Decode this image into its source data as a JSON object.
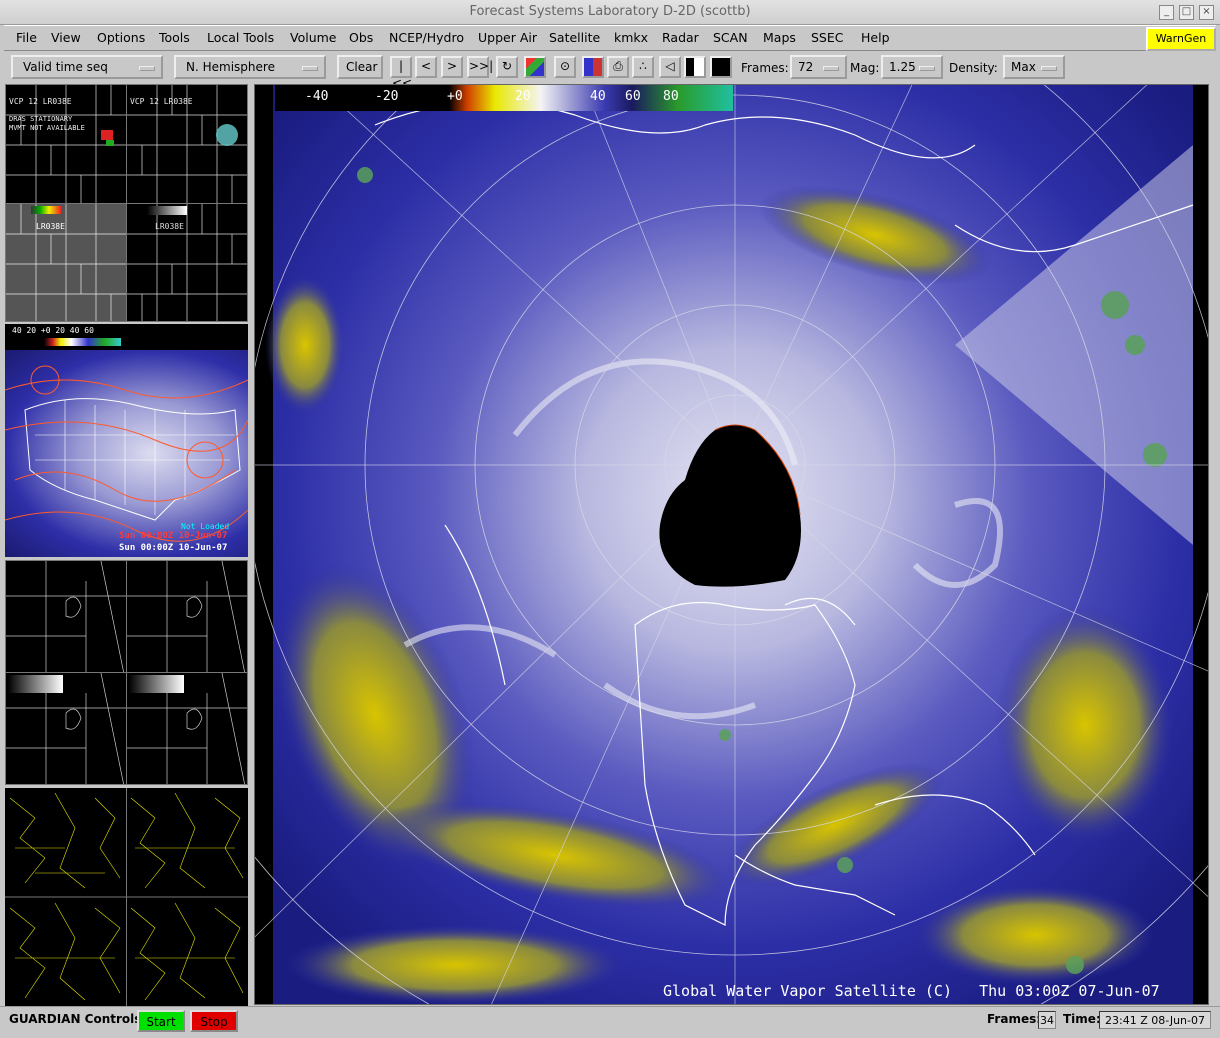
{
  "window": {
    "title": "Forecast Systems Laboratory D-2D (scottb)"
  },
  "menu": {
    "items": [
      "File",
      "View",
      "Options",
      "Tools",
      "Local Tools",
      "Volume",
      "Obs",
      "NCEP/Hydro",
      "Upper Air",
      "Satellite",
      "kmkx",
      "Radar",
      "SCAN",
      "Maps",
      "SSEC",
      "Help"
    ],
    "warngen": "WarnGen"
  },
  "toolbar": {
    "time_seq": "Valid time seq",
    "scale": "N. Hemisphere",
    "clear": "Clear",
    "frames_label": "Frames:",
    "frames_value": "72",
    "mag_label": "Mag:",
    "mag_value": "1.25",
    "density_label": "Density:",
    "density_value": "Max"
  },
  "colorbar": {
    "labels": [
      "-40",
      "-20",
      "+0",
      "20",
      "40",
      "60",
      "80"
    ]
  },
  "mainview": {
    "caption": "Global Water Vapor Satellite (C)   Thu 03:00Z 07-Jun-07"
  },
  "thumbs": {
    "radar_a_label": "VCP 12 LR038E",
    "radar_a_note1": "DRAS STATIONARY",
    "radar_a_note2": "MVMT NOT AVAILABLE",
    "radar_b_label": "VCP 12 LR038E",
    "radar_c_label": "LR038E",
    "radar_d_label": "LR038E",
    "us_time1": "Sun 00:00Z 10-Jun-07",
    "us_time2": "Sun 00:00Z 10-Jun-07",
    "us_loaded": "Not Loaded",
    "mini_colorbar": "40 20 +0 20 40 60"
  },
  "status": {
    "guardian_label": "GUARDIAN Controls:",
    "start": "Start",
    "stop": "Stop",
    "frames_label": "Frames:",
    "frames_value": "34",
    "time_label": "Time:",
    "time_value": "23:41 Z 08-Jun-07"
  },
  "colors": {
    "start": "#00e000",
    "stop": "#e00000",
    "warngen": "#ffff00",
    "accent_yellow": "#c8b400",
    "wv_blue": "#2a2ea8"
  }
}
